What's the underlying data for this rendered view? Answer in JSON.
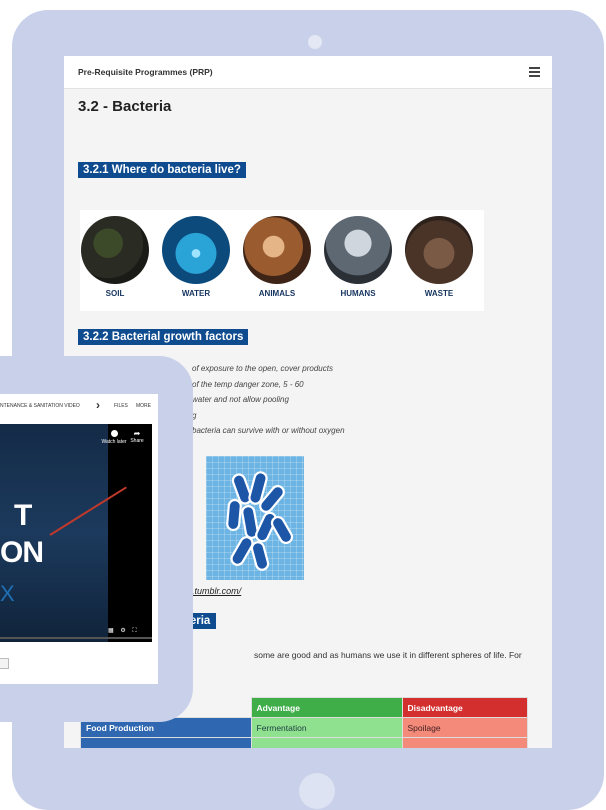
{
  "topbar": {
    "brand": "Pre-Requisite Programmes (PRP)",
    "menu_icon": "hamburger-menu-icon"
  },
  "page_title": "3.2 - Bacteria",
  "sections": {
    "where_live": "3.2.1 Where do bacteria live?",
    "growth_factors": "3.2.2 Bacterial growth factors",
    "types_partial": "teria"
  },
  "habitats": [
    {
      "label": "SOIL"
    },
    {
      "label": "WATER"
    },
    {
      "label": "ANIMALS"
    },
    {
      "label": "HUMANS"
    },
    {
      "label": "WASTE"
    }
  ],
  "growth_bullets": [
    "of exposure to the open, cover products",
    "of the temp danger zone, 5 - 60",
    "water and not allow pooling",
    "g",
    "bacteria can survive with or without oxygen"
  ],
  "image_credit": "h.tumblr.com/",
  "paragraph_fragment": "some are good and as humans we use it in different spheres of life. For",
  "table": {
    "headers": [
      "",
      "Advantage",
      "Disadvantage"
    ],
    "rows": [
      {
        "label": "Food Production",
        "advantage": "Fermentation",
        "disadvantage": "Spoilage"
      }
    ]
  },
  "video": {
    "nav_title": "NTENANCE & SANITATION VIDEO",
    "files": "FILES",
    "more": "MORE",
    "watch_later": "Watch later",
    "share": "Share",
    "title_line1": "T",
    "title_line2": "ON",
    "title_line3": "X"
  }
}
